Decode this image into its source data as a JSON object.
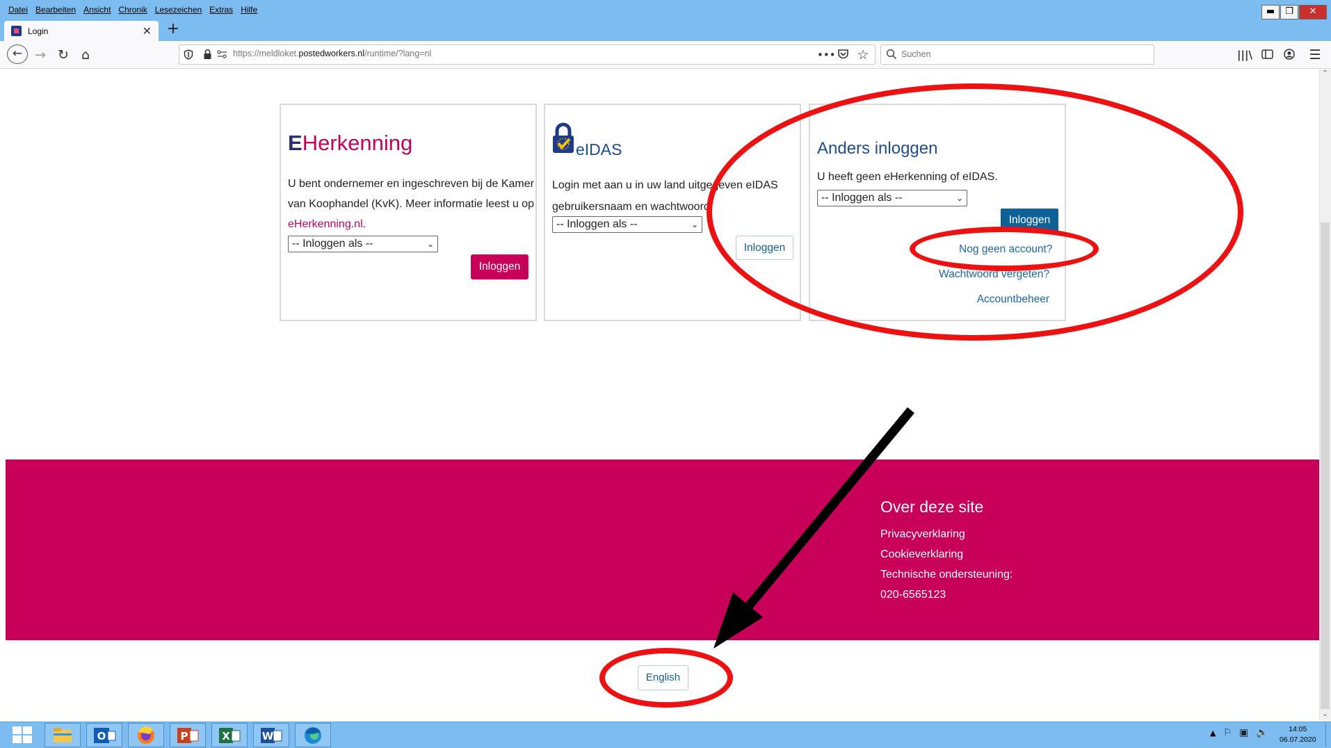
{
  "menu": [
    "Datei",
    "Bearbeiten",
    "Ansicht",
    "Chronik",
    "Lesezeichen",
    "Extras",
    "Hilfe"
  ],
  "tab": {
    "title": "Login",
    "close": "✕",
    "new": "+"
  },
  "window_controls": {
    "minimize": "▬",
    "restore": "❐",
    "close": "✕"
  },
  "address": {
    "prefix": "https://meldloket.",
    "domain": "postedworkers.nl",
    "path": "/runtime/?lang=nl"
  },
  "search": {
    "placeholder": "Suchen"
  },
  "nav_icons": [
    "back-icon",
    "forward-icon",
    "reload-icon",
    "home-icon",
    "shield-icon",
    "lock-icon",
    "permissions-icon",
    "more-icon",
    "pocket-icon",
    "bookmark-star-icon",
    "library-icon",
    "sidebar-icon",
    "account-icon",
    "menu-icon"
  ],
  "cards": {
    "eherkenning": {
      "logo_e": "E",
      "logo_rest": "Herkenning",
      "text": "U bent ondernemer en ingeschreven bij de Kamer van Koophandel (KvK). Meer informatie leest u op ",
      "link": "eHerkenning.nl",
      "after_link": ".",
      "select": "-- Inloggen als --",
      "button": "Inloggen"
    },
    "eidas": {
      "logo": "eIDAS",
      "text": "Login met aan u in uw land uitgegeven eIDAS gebruikersnaam en wachtwoord.",
      "select": "-- Inloggen als --",
      "button": "Inloggen"
    },
    "anders": {
      "title": "Anders inloggen",
      "text": "U heeft geen eHerkenning of eIDAS.",
      "select": "-- Inloggen als --",
      "button": "Inloggen",
      "link_account": "Nog geen account?",
      "link_password": "Wachtwoord vergeten?",
      "link_manage": "Accountbeheer"
    }
  },
  "footer": {
    "title": "Over deze site",
    "links": [
      "Privacyverklaring",
      "Cookieverklaring"
    ],
    "support_label": "Technische ondersteuning:",
    "phone": "020-6565123"
  },
  "language_button": "English",
  "colors": {
    "brand_pink": "#c8005a",
    "link_blue": "#1b67a8",
    "annotation_red": "#ee1111",
    "taskbar_blue": "#7cbcf1"
  },
  "taskbar": {
    "apps": [
      "windows-start-icon",
      "file-explorer-icon",
      "outlook-icon",
      "firefox-icon",
      "powerpoint-icon",
      "excel-icon",
      "word-icon",
      "edge-icon"
    ],
    "clock_time": "14:05",
    "clock_date": "06.07.2020"
  }
}
